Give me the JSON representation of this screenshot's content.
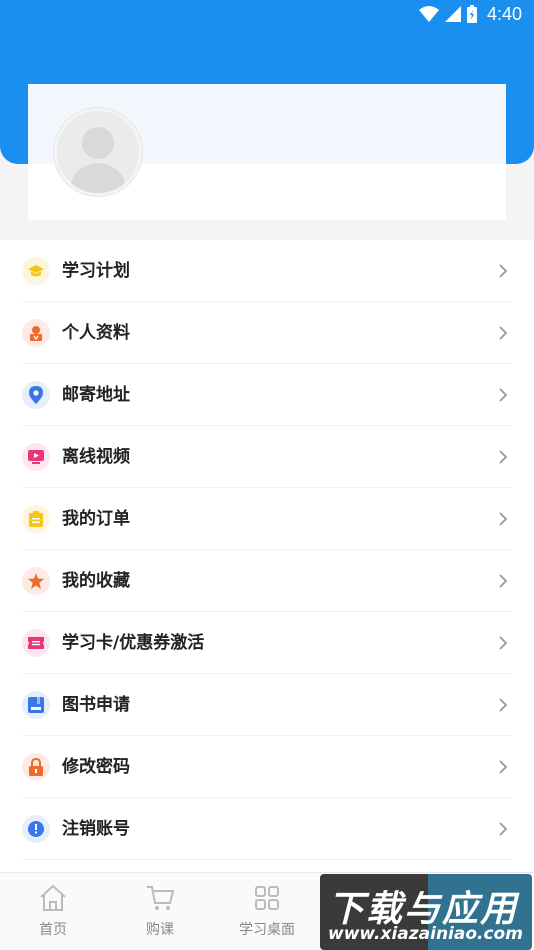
{
  "status_bar": {
    "time": "4:40"
  },
  "menu": {
    "items": [
      {
        "label": "学习计划",
        "icon": "graduation-cap-icon",
        "icon_color": "#f5c518",
        "bg": "#fdf6dc"
      },
      {
        "label": "个人资料",
        "icon": "person-icon",
        "icon_color": "#f06a2c",
        "bg": "#fdebe3"
      },
      {
        "label": "邮寄地址",
        "icon": "location-pin-icon",
        "icon_color": "#3b76e8",
        "bg": "#e6eefc"
      },
      {
        "label": "离线视频",
        "icon": "video-play-icon",
        "icon_color": "#e8367a",
        "bg": "#fde6ef"
      },
      {
        "label": "我的订单",
        "icon": "order-clipboard-icon",
        "icon_color": "#f5c518",
        "bg": "#fdf6dc"
      },
      {
        "label": "我的收藏",
        "icon": "star-icon",
        "icon_color": "#f06a2c",
        "bg": "#fdebe3"
      },
      {
        "label": "学习卡/优惠券激活",
        "icon": "ticket-icon",
        "icon_color": "#e8367a",
        "bg": "#fde6ef"
      },
      {
        "label": "图书申请",
        "icon": "book-icon",
        "icon_color": "#3b76e8",
        "bg": "#e6eefc"
      },
      {
        "label": "修改密码",
        "icon": "lock-icon",
        "icon_color": "#f06a2c",
        "bg": "#fdebe3"
      },
      {
        "label": "注销账号",
        "icon": "logout-clock-icon",
        "icon_color": "#3b76e8",
        "bg": "#e6eefc"
      }
    ]
  },
  "tabbar": {
    "tabs": [
      {
        "label": "首页",
        "icon": "home-icon"
      },
      {
        "label": "购课",
        "icon": "cart-icon"
      },
      {
        "label": "学习桌面",
        "icon": "grid-icon"
      }
    ]
  },
  "watermark": {
    "main": "下载与应用",
    "sub": "www.xiazainiao.com"
  },
  "colors": {
    "header_blue": "#1a8ff0",
    "chevron": "#999999",
    "tab_inactive": "#888888"
  }
}
